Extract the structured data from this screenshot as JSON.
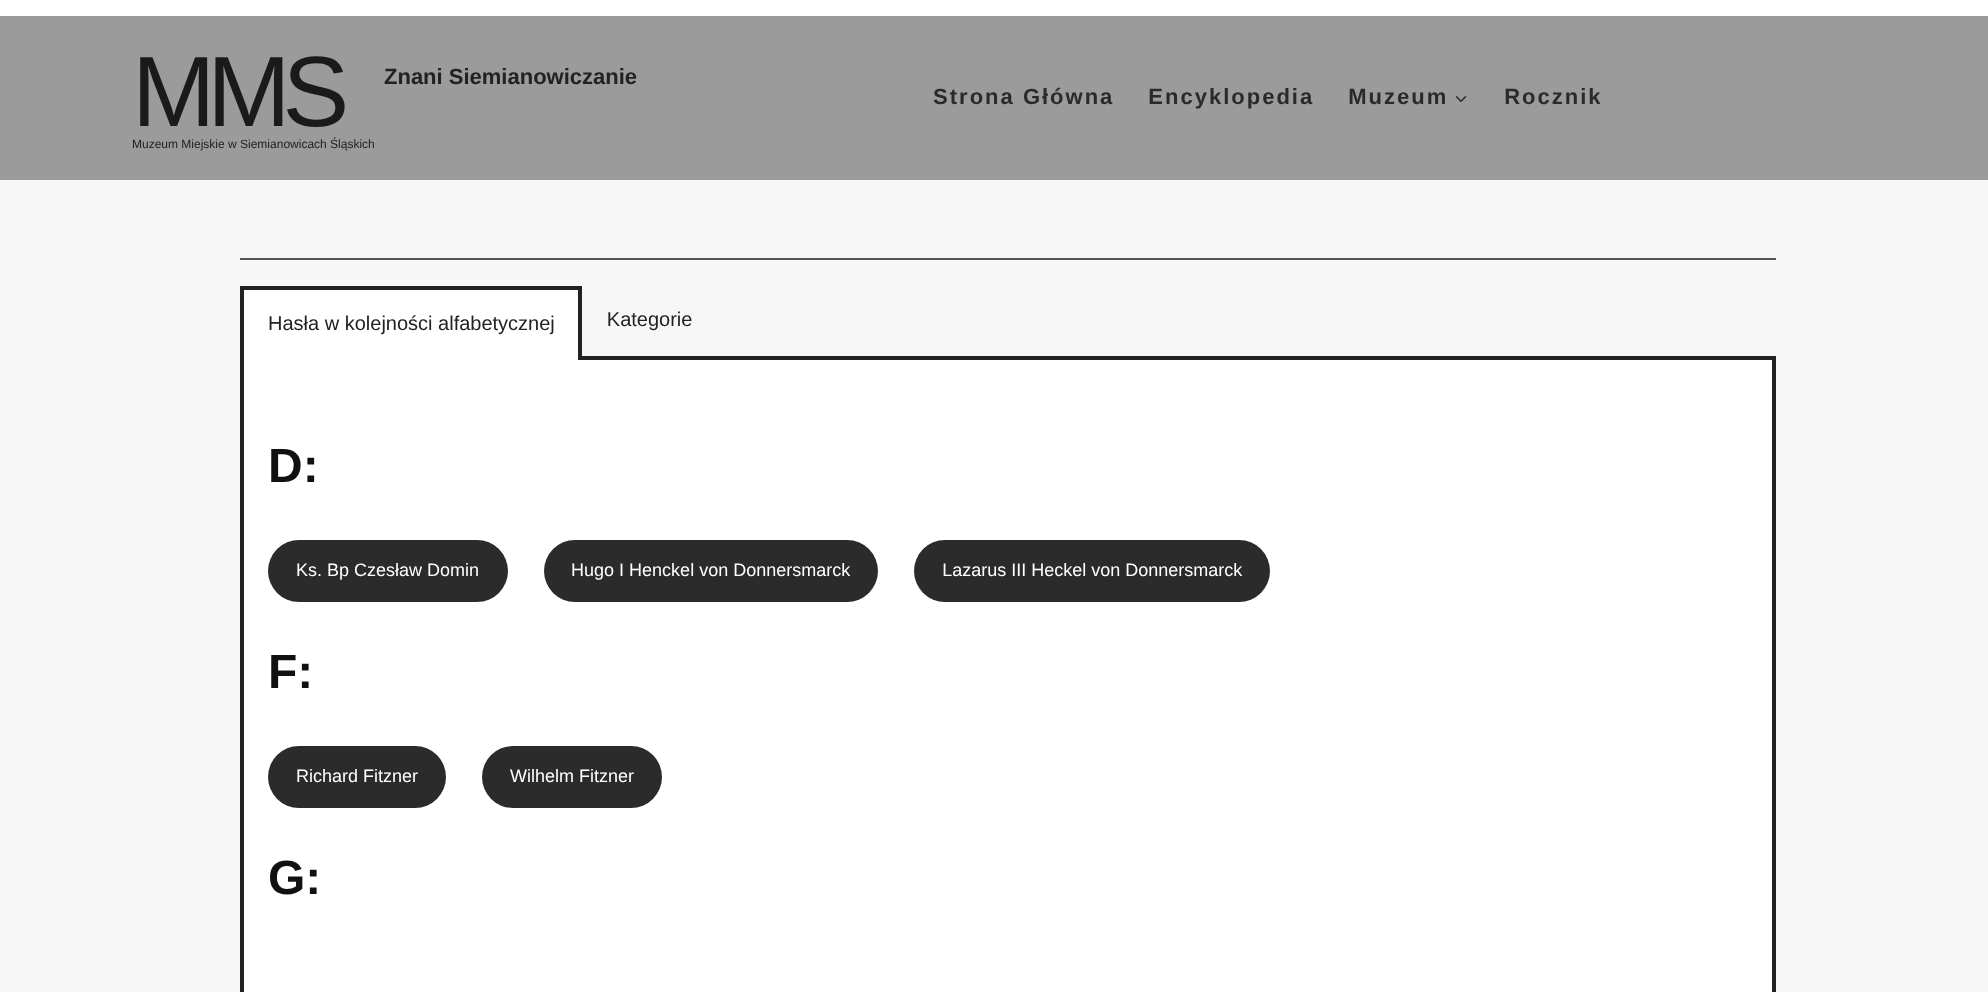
{
  "header": {
    "logo_letters": "MMS",
    "logo_caption": "Muzeum Miejskie w Siemianowicach Śląskich",
    "site_title": "Znani Siemianowiczanie",
    "nav": [
      {
        "label": "Strona Główna",
        "dropdown": false
      },
      {
        "label": "Encyklopedia",
        "dropdown": false
      },
      {
        "label": "Muzeum",
        "dropdown": true
      },
      {
        "label": "Rocznik",
        "dropdown": false
      }
    ]
  },
  "tabs": [
    {
      "label": "Hasła w kolejności alfabetycznej",
      "selected": true
    },
    {
      "label": "Kategorie",
      "selected": false
    }
  ],
  "sections": [
    {
      "letter": "D:",
      "entries": [
        "Ks. Bp Czesław Domin",
        "Hugo I Henckel von Donnersmarck",
        "Lazarus III Heckel von Donnersmarck"
      ]
    },
    {
      "letter": "F:",
      "entries": [
        "Richard Fitzner",
        "Wilhelm Fitzner"
      ]
    },
    {
      "letter": "G:"
    }
  ]
}
